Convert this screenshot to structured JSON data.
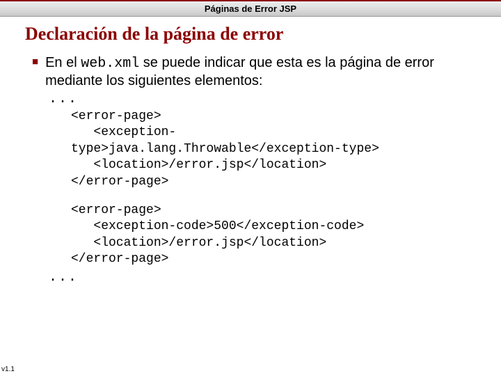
{
  "header": {
    "title": "Páginas de Error JSP"
  },
  "slide": {
    "title": "Declaración de la página de error"
  },
  "bullet": {
    "text_prefix": "En el ",
    "code_inline": "web.xml",
    "text_suffix": " se puede indicar que esta es la página de error mediante los siguientes elementos:"
  },
  "code": {
    "ellipsis_top": "...",
    "block1": "<error-page>\n   <exception-\ntype>java.lang.Throwable</exception-type>\n   <location>/error.jsp</location>\n</error-page>",
    "block2": "<error-page>\n   <exception-code>500</exception-code>\n   <location>/error.jsp</location>\n</error-page>",
    "ellipsis_bottom": "..."
  },
  "footer": {
    "version": "v1.1"
  }
}
